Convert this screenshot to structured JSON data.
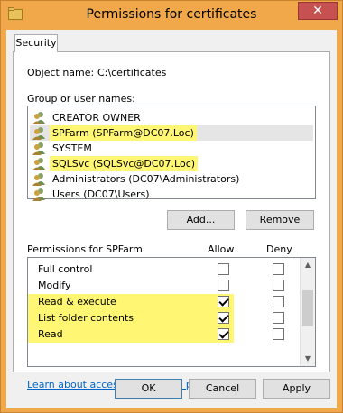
{
  "window": {
    "title": "Permissions for certificates",
    "close_label": "✕"
  },
  "tab": {
    "label": "Security"
  },
  "object": {
    "label": "Object name:",
    "value": "C:\\certificates"
  },
  "group_label": "Group or user names:",
  "users": [
    {
      "name": "CREATOR OWNER",
      "highlight": false,
      "selected": false
    },
    {
      "name": "SPFarm (SPFarm@DC07.Loc)",
      "highlight": true,
      "selected": true
    },
    {
      "name": "SYSTEM",
      "highlight": false,
      "selected": false
    },
    {
      "name": "SQLSvc (SQLSvc@DC07.Loc)",
      "highlight": true,
      "selected": false
    },
    {
      "name": "Administrators (DC07\\Administrators)",
      "highlight": false,
      "selected": false
    },
    {
      "name": "Users (DC07\\Users)",
      "highlight": false,
      "selected": false
    }
  ],
  "buttons": {
    "add": "Add...",
    "remove": "Remove",
    "ok": "OK",
    "cancel": "Cancel",
    "apply": "Apply"
  },
  "permissions": {
    "header": "Permissions for SPFarm",
    "allow_header": "Allow",
    "deny_header": "Deny",
    "rows": [
      {
        "name": "Full control",
        "allow": false,
        "deny": false,
        "highlight": false
      },
      {
        "name": "Modify",
        "allow": false,
        "deny": false,
        "highlight": false
      },
      {
        "name": "Read & execute",
        "allow": true,
        "deny": false,
        "highlight": true
      },
      {
        "name": "List folder contents",
        "allow": true,
        "deny": false,
        "highlight": true
      },
      {
        "name": "Read",
        "allow": true,
        "deny": false,
        "highlight": true
      }
    ]
  },
  "link": "Learn about access control and permissions",
  "colors": {
    "highlight": "#fff774",
    "titlebar": "#f0a84a",
    "link": "#0066cc"
  }
}
